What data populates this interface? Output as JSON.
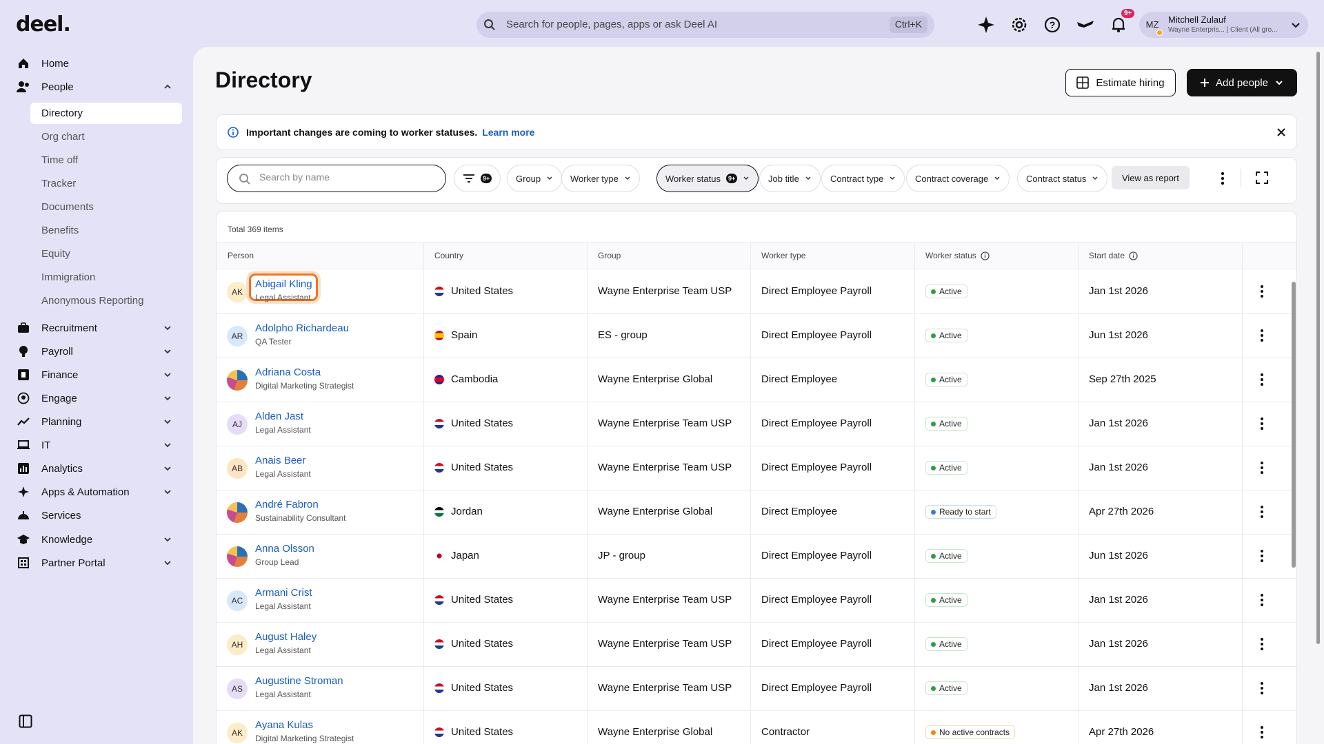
{
  "app": {
    "logo": "deel."
  },
  "topbar": {
    "search_placeholder": "Search for people, pages, apps or ask Deel AI",
    "search_shortcut": "Ctrl+K",
    "notifications_badge": "9+",
    "user": {
      "initials": "MZ",
      "name": "Mitchell Zulauf",
      "subtitle": "Wayne Enterpris... | Client (All gro..."
    }
  },
  "sidebar": {
    "home": "Home",
    "people": "People",
    "people_sub": [
      "Directory",
      "Org chart",
      "Time off",
      "Tracker",
      "Documents",
      "Benefits",
      "Equity",
      "Immigration",
      "Anonymous Reporting"
    ],
    "active_sub": "Directory",
    "sections": [
      "Recruitment",
      "Payroll",
      "Finance",
      "Engage",
      "Planning",
      "IT",
      "Analytics",
      "Apps & Automation",
      "Services",
      "Knowledge",
      "Partner Portal"
    ]
  },
  "page": {
    "title": "Directory",
    "estimate_label": "Estimate hiring",
    "add_label": "Add people"
  },
  "banner": {
    "text": "Important changes are coming to worker statuses.",
    "link": "Learn more"
  },
  "filters": {
    "search_placeholder": "Search by name",
    "filter_count": "9+",
    "chips": [
      "Group",
      "Worker type",
      "Worker status",
      "Job title",
      "Contract type",
      "Contract coverage",
      "Contract status"
    ],
    "worker_status_count": "9+",
    "view_report": "View as report"
  },
  "table": {
    "total": "Total 369 items",
    "headers": [
      "Person",
      "Country",
      "Group",
      "Worker type",
      "Worker status",
      "Start date"
    ],
    "rows": [
      {
        "initials": "AK",
        "name": "Abigail Kling",
        "role": "Legal Assistant",
        "country": "United States",
        "group": "Wayne Enterprise Team USP",
        "type": "Direct Employee Payroll",
        "status": "Active",
        "start": "Jan 1st 2026"
      },
      {
        "initials": "AR",
        "name": "Adolpho Richardeau",
        "role": "QA Tester",
        "country": "Spain",
        "group": "ES - group",
        "type": "Direct Employee Payroll",
        "status": "Active",
        "start": "Jun 1st 2026"
      },
      {
        "initials": "",
        "name": "Adriana Costa",
        "role": "Digital Marketing Strategist",
        "country": "Cambodia",
        "group": "Wayne Enterprise Global",
        "type": "Direct Employee",
        "status": "Active",
        "start": "Sep 27th 2025"
      },
      {
        "initials": "AJ",
        "name": "Alden Jast",
        "role": "Legal Assistant",
        "country": "United States",
        "group": "Wayne Enterprise Team USP",
        "type": "Direct Employee Payroll",
        "status": "Active",
        "start": "Jan 1st 2026"
      },
      {
        "initials": "AB",
        "name": "Anais Beer",
        "role": "Legal Assistant",
        "country": "United States",
        "group": "Wayne Enterprise Team USP",
        "type": "Direct Employee Payroll",
        "status": "Active",
        "start": "Jan 1st 2026"
      },
      {
        "initials": "",
        "name": "André Fabron",
        "role": "Sustainability Consultant",
        "country": "Jordan",
        "group": "Wayne Enterprise Global",
        "type": "Direct Employee",
        "status": "Ready to start",
        "start": "Apr 27th 2026"
      },
      {
        "initials": "",
        "name": "Anna Olsson",
        "role": "Group Lead",
        "country": "Japan",
        "group": "JP - group",
        "type": "Direct Employee Payroll",
        "status": "Active",
        "start": "Jun 1st 2026"
      },
      {
        "initials": "AC",
        "name": "Armani Crist",
        "role": "Legal Assistant",
        "country": "United States",
        "group": "Wayne Enterprise Team USP",
        "type": "Direct Employee Payroll",
        "status": "Active",
        "start": "Jan 1st 2026"
      },
      {
        "initials": "AH",
        "name": "August Haley",
        "role": "Legal Assistant",
        "country": "United States",
        "group": "Wayne Enterprise Team USP",
        "type": "Direct Employee Payroll",
        "status": "Active",
        "start": "Jan 1st 2026"
      },
      {
        "initials": "AS",
        "name": "Augustine Stroman",
        "role": "Legal Assistant",
        "country": "United States",
        "group": "Wayne Enterprise Team USP",
        "type": "Direct Employee Payroll",
        "status": "Active",
        "start": "Jan 1st 2026"
      },
      {
        "initials": "AK",
        "name": "Ayana Kulas",
        "role": "Digital Marketing Strategist",
        "country": "United States",
        "group": "Wayne Enterprise Global",
        "type": "Contractor",
        "status": "No active contracts",
        "start": "Apr 27th 2026"
      }
    ]
  },
  "colors": {
    "accent": "#1b5cc4",
    "active": "#2e9e44",
    "ready": "#3a7bd5",
    "warning": "#f08c00",
    "focus": "#f37321"
  }
}
